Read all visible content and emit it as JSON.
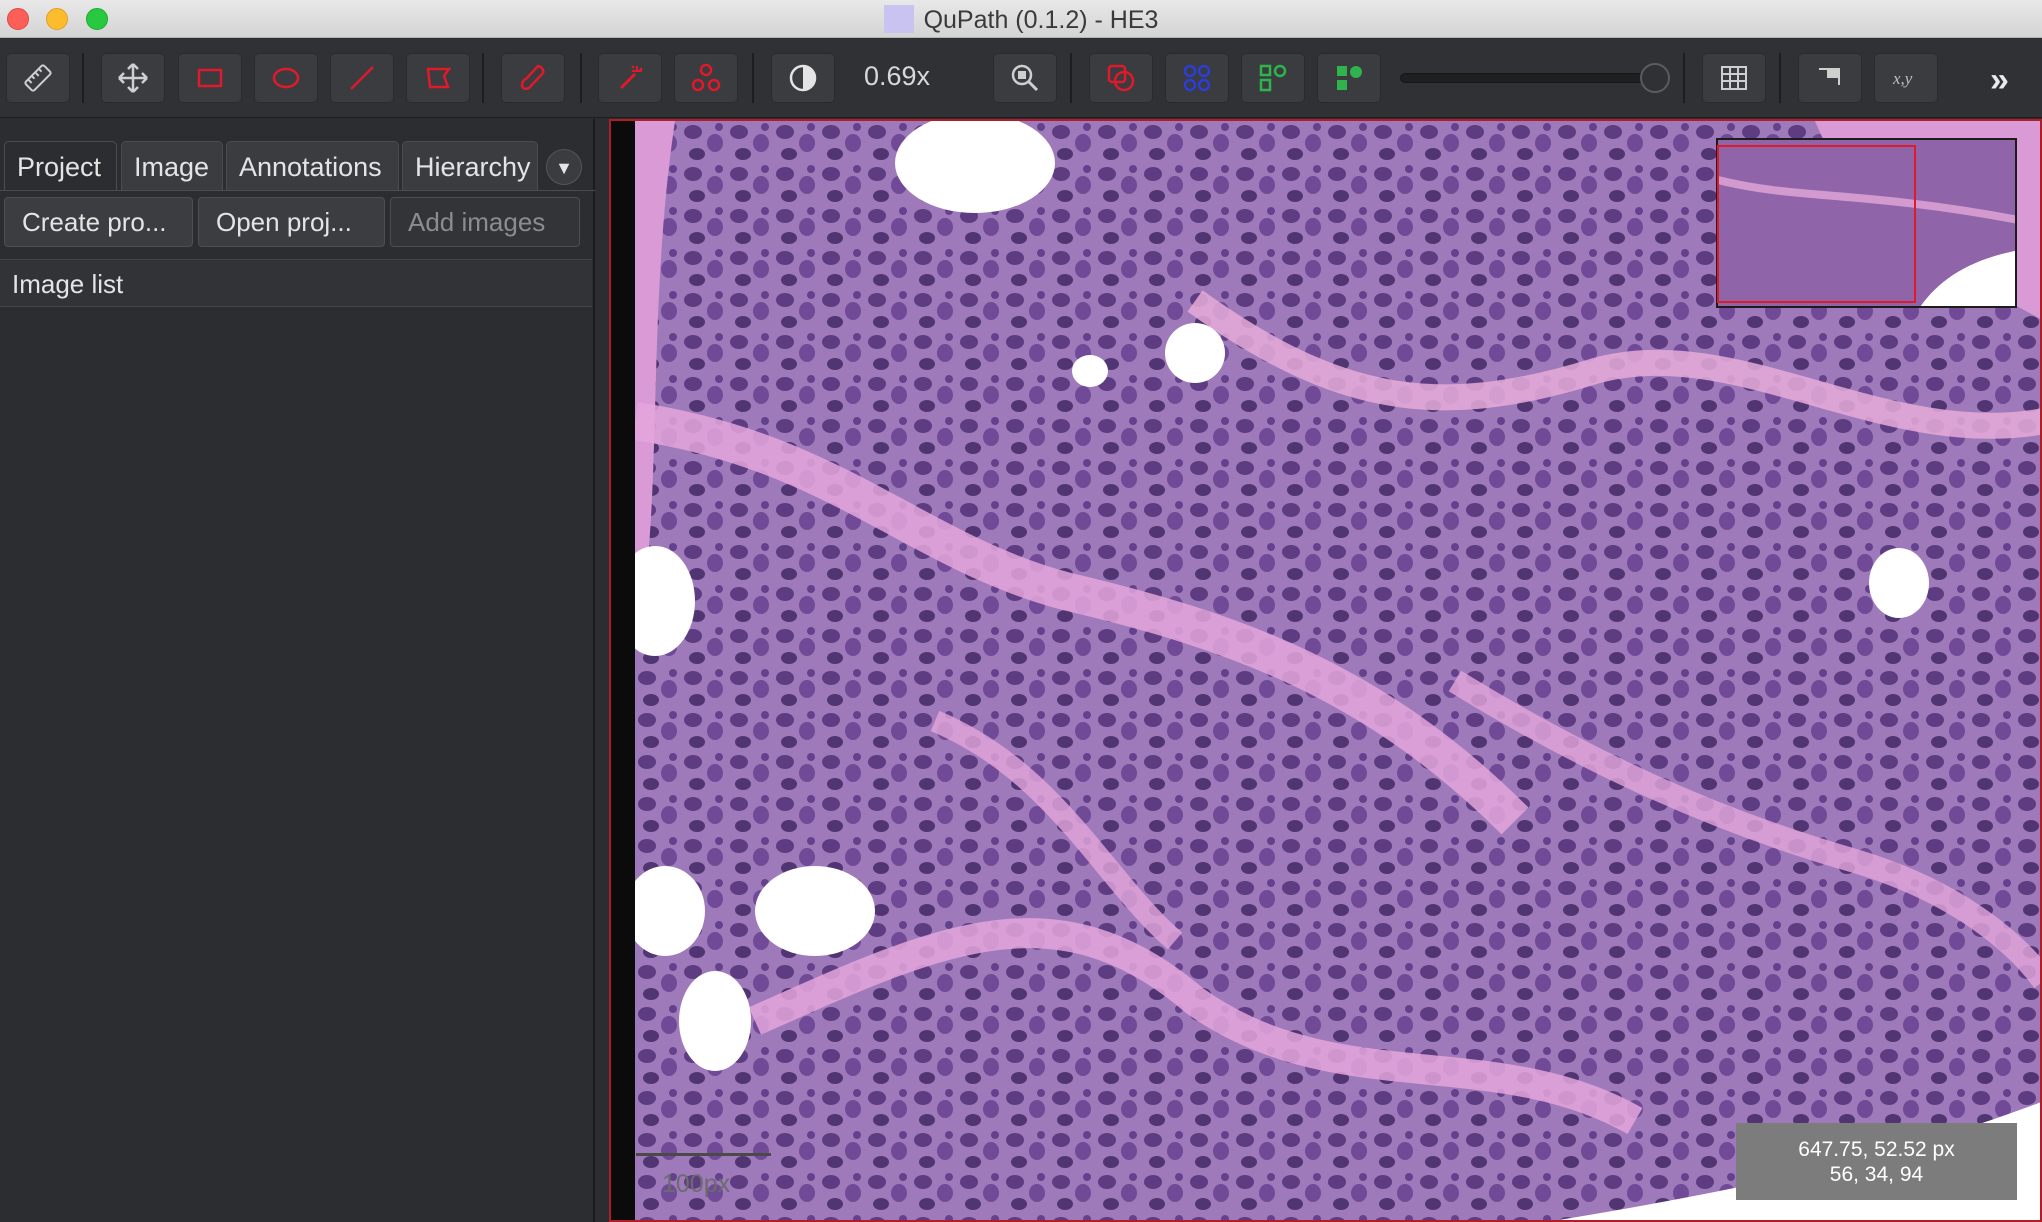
{
  "window": {
    "title": "QuPath (0.1.2) - HE3"
  },
  "toolbar": {
    "buttons": [
      {
        "icon": "ruler-icon"
      },
      {
        "icon": "move-icon"
      },
      {
        "icon": "rectangle-icon"
      },
      {
        "icon": "ellipse-icon"
      },
      {
        "icon": "line-icon"
      },
      {
        "icon": "polygon-icon"
      },
      {
        "icon": "brush-icon"
      },
      {
        "icon": "wand-icon"
      },
      {
        "icon": "points-icon"
      },
      {
        "icon": "brightness-contrast-icon"
      },
      {
        "icon": "zoom-to-fit-icon"
      },
      {
        "icon": "show-annotations-icon"
      },
      {
        "icon": "show-tma-grid-icon"
      },
      {
        "icon": "show-detections-icon"
      },
      {
        "icon": "fill-detections-icon"
      },
      {
        "icon": "show-overview-icon"
      },
      {
        "icon": "show-grid-icon"
      },
      {
        "icon": "show-scalebar-icon"
      },
      {
        "icon": "show-cursor-location-icon"
      }
    ],
    "zoom_label": "0.69x",
    "opacity_slider_value": 1.0,
    "more_label": "»"
  },
  "left_panel": {
    "tabs": [
      "Project",
      "Image",
      "Annotations",
      "Hierarchy"
    ],
    "active_tab": "Project",
    "buttons": {
      "create_project": "Create pro...",
      "open_project": "Open proj...",
      "add_images": "Add images"
    },
    "image_list_title": "Image list"
  },
  "viewer": {
    "scalebar_label": "100px",
    "cursor_location": "647.75, 52.52 px",
    "pixel_value": "56, 34, 94"
  },
  "colors": {
    "accent_red": "#e0192b",
    "tissue_stroma": "#d99ad6",
    "tissue_nuclei": "#56377e",
    "tissue_cytoplasm": "#9b78b8",
    "panel_bg": "#2b2d30"
  }
}
